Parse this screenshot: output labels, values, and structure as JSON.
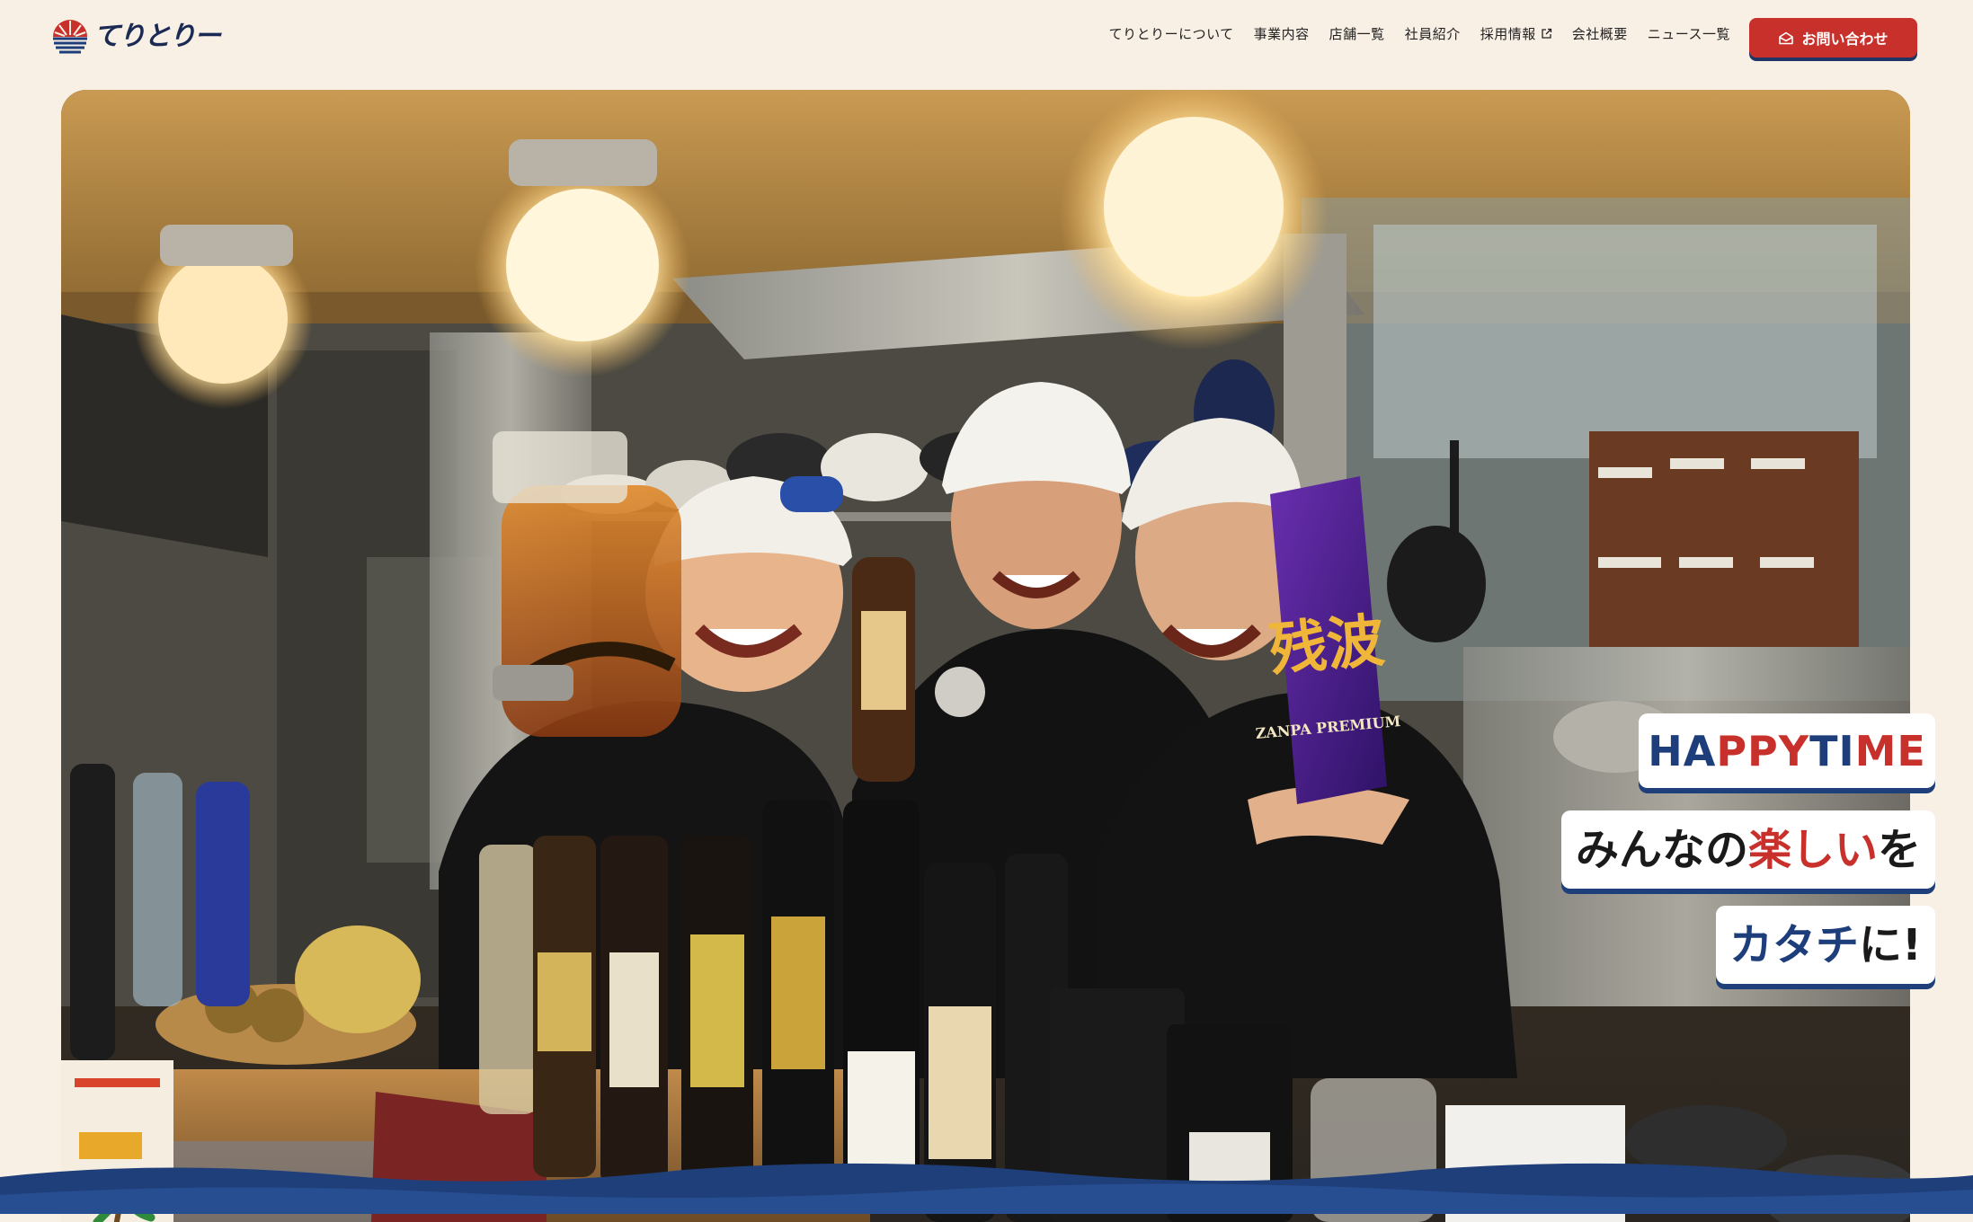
{
  "brand": {
    "name": "てりとりー"
  },
  "nav": {
    "items": [
      {
        "label": "てりとりーについて"
      },
      {
        "label": "事業内容"
      },
      {
        "label": "店舗一覧"
      },
      {
        "label": "社員紹介"
      },
      {
        "label": "採用情報"
      },
      {
        "label": "会社概要"
      },
      {
        "label": "ニュース一覧"
      }
    ],
    "contact_label": "お問い合わせ"
  },
  "hero": {
    "tagline": {
      "line1": {
        "part_a": "HA",
        "part_b": "PPY",
        "part_c": " TI",
        "part_d": "ME"
      },
      "line2": {
        "part_a": "みんなの",
        "part_b": "楽しい",
        "part_c": "を"
      },
      "line3": {
        "part_a": "カタチ",
        "part_b": "に!"
      }
    },
    "bottle_labels": {
      "zanpa": "ZANPA PREMIUM",
      "zanpa_kanji": "残波"
    }
  },
  "colors": {
    "background": "#f8efe5",
    "brand_navy": "#1d3e7b",
    "brand_red": "#c8312b",
    "wave_blue": "#1f3f7a"
  },
  "icons": [
    "logo-sun-icon",
    "external-link-icon",
    "mail-icon"
  ]
}
